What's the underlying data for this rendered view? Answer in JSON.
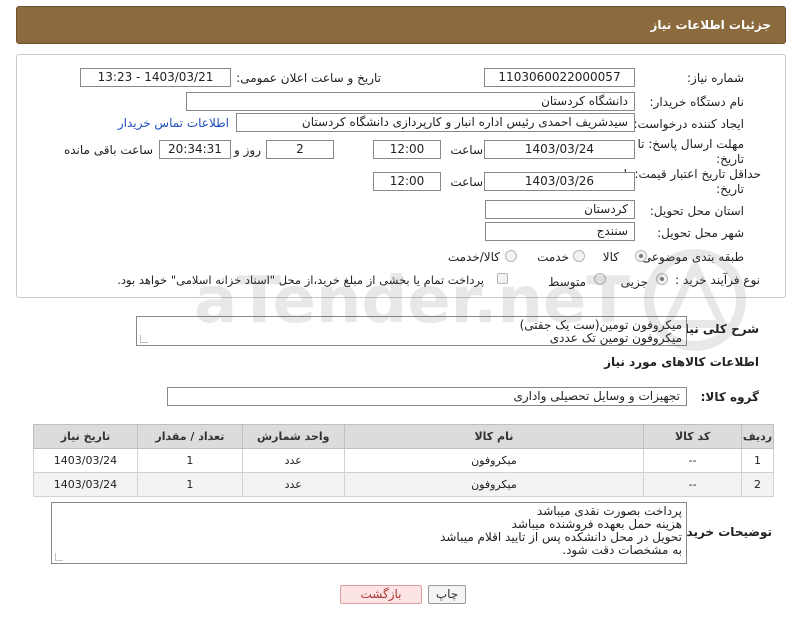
{
  "header": {
    "title": "جزئیات اطلاعات نیاز"
  },
  "form": {
    "need_number_label": "شماره نیاز:",
    "need_number": "1103060022000057",
    "announce_label": "تاریخ و ساعت اعلان عمومی:",
    "announce_value": "1403/03/21 - 13:23",
    "buyer_org_label": "نام دستگاه خریدار:",
    "buyer_org": "دانشگاه کردستان",
    "requester_label": "ایجاد کننده درخواست:",
    "requester": "سیدشریف احمدی رئیس اداره انبار و کارپردازی دانشگاه کردستان",
    "contact_link": "اطلاعات تماس خریدار",
    "reply_deadline_label_1": "مهلت ارسال پاسخ: تا",
    "reply_deadline_label_2": "تاریخ:",
    "reply_date": "1403/03/24",
    "time_label": "ساعت",
    "reply_time": "12:00",
    "days_value": "2",
    "days_label": "روز و",
    "remaining_value": "20:34:31",
    "remaining_label": "ساعت باقی مانده",
    "validity_label_1": "حداقل تاریخ اعتبار قیمت: تا",
    "validity_label_2": "تاریخ:",
    "validity_date": "1403/03/26",
    "validity_time": "12:00",
    "province_label": "استان محل تحویل:",
    "province": "کردستان",
    "city_label": "شهر محل تحویل:",
    "city": "سنندج",
    "category_label": "طبقه بندی موضوعی:",
    "category_options": [
      "کالا",
      "خدمت",
      "کالا/خدمت"
    ],
    "process_label": "نوع فرآیند خرید :",
    "process_options": [
      "جزیی",
      "متوسط"
    ],
    "payment_text": "پرداخت تمام یا بخشی از مبلغ خرید،از محل \"اسناد خزانه اسلامی\" خواهد بود."
  },
  "summary": {
    "label": "شرح کلی نیاز:",
    "line1": "میکروفون تومین(ست یک جفتی)",
    "line2": "میکروفون تومین تک عددی"
  },
  "goods": {
    "section_title": "اطلاعات کالاهای مورد نیاز",
    "group_label": "گروه کالا:",
    "group_value": "تجهیزات و وسایل تحصیلی واداری",
    "columns": [
      "ردیف",
      "کد کالا",
      "نام کالا",
      "واحد شمارش",
      "تعداد / مقدار",
      "تاریخ نیاز"
    ],
    "rows": [
      [
        "1",
        "--",
        "میکروفون",
        "عدد",
        "1",
        "1403/03/24"
      ],
      [
        "2",
        "--",
        "میکروفون",
        "عدد",
        "1",
        "1403/03/24"
      ]
    ]
  },
  "notes": {
    "label": "توضیحات خریدار:",
    "line1": "پرداخت بصورت نقدی میباشد",
    "line2": "هزینه حمل بعهده فروشنده میباشد",
    "line3": "تحویل در محل دانشکده پس از تایید اقلام میباشد",
    "line4": "به مشخصات دقت شود."
  },
  "buttons": {
    "print": "چاپ",
    "back": "بازگشت"
  },
  "watermark": {
    "text": "AriaTender.neT"
  },
  "colors": {
    "header_bg": "#8b6a3e",
    "link": "#1f4fbf",
    "back_button_bg": "#fde4e4"
  }
}
